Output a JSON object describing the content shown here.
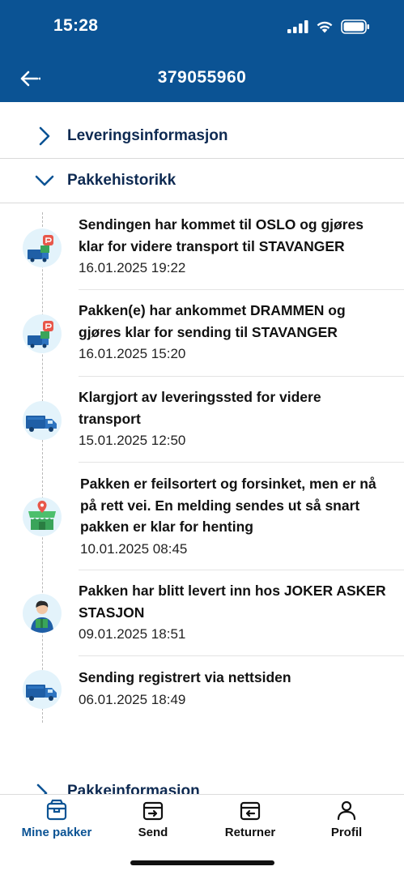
{
  "status_bar": {
    "time": "15:28"
  },
  "nav": {
    "title": "379055960",
    "back_icon": "arrow-left-icon"
  },
  "sections": {
    "delivery_info": "Leveringsinformasjon",
    "package_history": "Pakkehistorikk",
    "package_info": "Pakkeinformasjon"
  },
  "events": [
    {
      "description": "Sendingen har kommet til OSLO og gjøres klar for videre transport til STAVANGER",
      "date": "16.01.2025 19:22",
      "icon": "truck-package-icon"
    },
    {
      "description": "Pakken(e) har ankommet DRAMMEN og gjøres klar for sending til STAVANGER",
      "date": "16.01.2025 15:20",
      "icon": "truck-package-icon"
    },
    {
      "description": "Klargjort av leveringssted for videre transport",
      "date": "15.01.2025 12:50",
      "icon": "truck-icon"
    },
    {
      "description": "Pakken er feilsortert og forsinket, men er nå på rett vei. En melding sendes ut så snart pakken er klar for henting",
      "date": "10.01.2025 08:45",
      "icon": "store-location-icon"
    },
    {
      "description": "Pakken har blitt levert inn hos JOKER ASKER STASJON",
      "date": "09.01.2025 18:51",
      "icon": "person-package-icon"
    },
    {
      "description": "Sending registrert via nettsiden",
      "date": "06.01.2025 18:49",
      "icon": "truck-icon"
    }
  ],
  "tabs": [
    {
      "label": "Mine pakker",
      "icon": "package-icon",
      "active": true
    },
    {
      "label": "Send",
      "icon": "send-package-icon",
      "active": false
    },
    {
      "label": "Returner",
      "icon": "return-package-icon",
      "active": false
    },
    {
      "label": "Profil",
      "icon": "person-icon",
      "active": false
    }
  ],
  "colors": {
    "header_bg": "#0b5394",
    "section_text": "#0e2a52",
    "icon_bg": "#e3f3fb",
    "accent_red": "#e8574a",
    "truck_blue": "#1f5fa6",
    "store_green": "#3aa45a"
  }
}
